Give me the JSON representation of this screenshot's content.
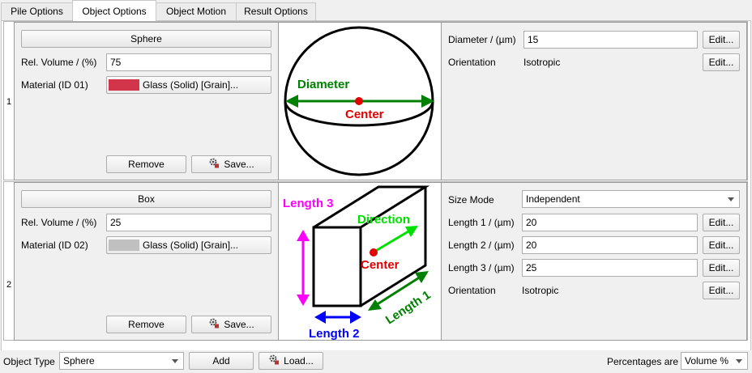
{
  "tabs": [
    {
      "label": "Pile Options"
    },
    {
      "label": "Object Options"
    },
    {
      "label": "Object Motion"
    },
    {
      "label": "Result Options"
    }
  ],
  "active_tab": 1,
  "rows": [
    {
      "number": "1",
      "shape_button": "Sphere",
      "rel_volume_label": "Rel. Volume / (%)",
      "rel_volume_value": "75",
      "material_label": "Material (ID 01)",
      "material_value": "Glass (Solid) [Grain]...",
      "material_color": "#d2344a",
      "remove_label": "Remove",
      "save_label": "Save...",
      "diagram": {
        "diameter_label": "Diameter",
        "center_label": "Center"
      },
      "params": {
        "diameter_label": "Diameter / (µm)",
        "diameter_value": "15",
        "orientation_label": "Orientation",
        "orientation_value": "Isotropic",
        "edit_label": "Edit..."
      }
    },
    {
      "number": "2",
      "shape_button": "Box",
      "rel_volume_label": "Rel. Volume / (%)",
      "rel_volume_value": "25",
      "material_label": "Material (ID 02)",
      "material_value": "Glass (Solid) [Grain]...",
      "material_color": "#c0c0c0",
      "remove_label": "Remove",
      "save_label": "Save...",
      "diagram": {
        "length1_label": "Length 1",
        "length2_label": "Length 2",
        "length3_label": "Length 3",
        "direction_label": "Direction",
        "center_label": "Center"
      },
      "params": {
        "size_mode_label": "Size Mode",
        "size_mode_value": "Independent",
        "length1_label": "Length 1 / (µm)",
        "length1_value": "20",
        "length2_label": "Length 2 / (µm)",
        "length2_value": "20",
        "length3_label": "Length 3 / (µm)",
        "length3_value": "25",
        "orientation_label": "Orientation",
        "orientation_value": "Isotropic",
        "edit_label": "Edit..."
      }
    }
  ],
  "bottom": {
    "object_type_label": "Object Type",
    "object_type_value": "Sphere",
    "add_label": "Add",
    "load_label": "Load...",
    "percentages_label": "Percentages are",
    "percentages_value": "Volume %"
  },
  "colors": {
    "diameter": "#008000",
    "center": "#e00000",
    "length1": "#008000",
    "length2": "#0000ff",
    "length3": "#ff00ff",
    "direction": "#00e000"
  },
  "icons": {
    "save": "save-gear-icon",
    "load": "load-gear-icon"
  }
}
